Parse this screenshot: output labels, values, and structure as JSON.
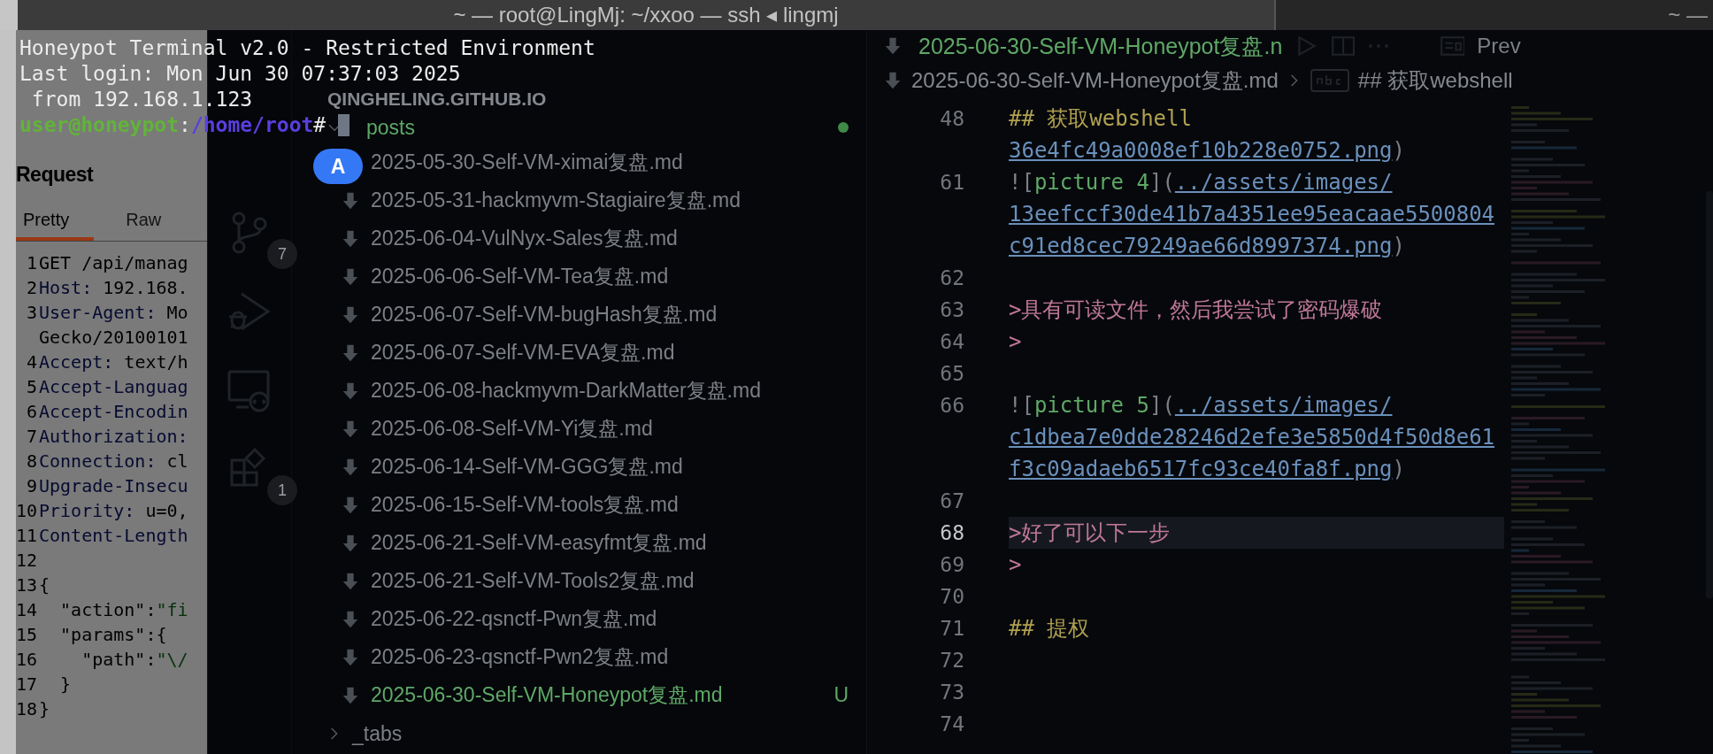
{
  "terminal": {
    "title": "~ — root@LingMj: ~/xxoo — ssh ◂ lingmj",
    "lines": [
      "Honeypot Terminal v2.0 - Restricted Environment",
      "Last login: Mon Jun 30 07:37:03 2025",
      " from 192.168.1.123"
    ],
    "prompt": {
      "user": "user@honeypot",
      "separator": ":",
      "path": "/home/root",
      "symbol": "#"
    },
    "input_badge": "A"
  },
  "second_window": {
    "title": "~ —"
  },
  "burp": {
    "heading": "Request",
    "tabs": [
      {
        "label": "Pretty",
        "selected": true
      },
      {
        "label": "Raw",
        "selected": false
      }
    ],
    "lines": [
      {
        "number": "1",
        "parts": [
          {
            "kind": "plain",
            "text": "GET /api/manag"
          }
        ]
      },
      {
        "number": "2",
        "parts": [
          {
            "kind": "name",
            "text": "Host:"
          },
          {
            "kind": "plain",
            "text": " 192.168."
          }
        ]
      },
      {
        "number": "3",
        "parts": [
          {
            "kind": "name",
            "text": "User-Agent:"
          },
          {
            "kind": "plain",
            "text": " Mo"
          }
        ]
      },
      {
        "parts": [
          {
            "kind": "plain",
            "text": "Gecko/20100101"
          }
        ]
      },
      {
        "number": "4",
        "parts": [
          {
            "kind": "name",
            "text": "Accept:"
          },
          {
            "kind": "plain",
            "text": " text/h"
          }
        ]
      },
      {
        "number": "5",
        "parts": [
          {
            "kind": "name",
            "text": "Accept-Languag"
          }
        ]
      },
      {
        "number": "6",
        "parts": [
          {
            "kind": "name",
            "text": "Accept-Encodin"
          }
        ]
      },
      {
        "number": "7",
        "parts": [
          {
            "kind": "name",
            "text": "Authorization:"
          }
        ]
      },
      {
        "number": "8",
        "parts": [
          {
            "kind": "name",
            "text": "Connection:"
          },
          {
            "kind": "plain",
            "text": " cl"
          }
        ]
      },
      {
        "number": "9",
        "parts": [
          {
            "kind": "name",
            "text": "Upgrade-Insecu"
          }
        ]
      },
      {
        "number": "10",
        "parts": [
          {
            "kind": "name",
            "text": "Priority:"
          },
          {
            "kind": "plain",
            "text": " u=0,"
          }
        ]
      },
      {
        "number": "11",
        "parts": [
          {
            "kind": "name",
            "text": "Content-Length"
          }
        ]
      },
      {
        "number": "12"
      },
      {
        "number": "13",
        "parts": [
          {
            "kind": "plain",
            "text": "{"
          }
        ]
      },
      {
        "number": "14",
        "parts": [
          {
            "kind": "plain",
            "text": "  \"action\":"
          },
          {
            "kind": "value",
            "text": "\"fi"
          }
        ]
      },
      {
        "number": "15",
        "parts": [
          {
            "kind": "plain",
            "text": "  \"params\":{"
          }
        ]
      },
      {
        "number": "16",
        "parts": [
          {
            "kind": "plain",
            "text": "    \"path\":"
          },
          {
            "kind": "value",
            "text": "\"\\/"
          }
        ]
      },
      {
        "number": "17",
        "parts": [
          {
            "kind": "plain",
            "text": "  }"
          }
        ]
      },
      {
        "number": "18",
        "parts": [
          {
            "kind": "plain",
            "text": "}"
          }
        ]
      }
    ]
  },
  "activity_bar": [
    {
      "kind": "source-control",
      "badge": "7"
    },
    {
      "kind": "debug"
    },
    {
      "kind": "remote"
    },
    {
      "kind": "extensions",
      "badge": "1"
    }
  ],
  "explorer": {
    "root": "QINGHELING.GITHUB.IO",
    "folders": [
      {
        "name": "posts",
        "expanded": true,
        "modified": true,
        "children": [
          {
            "name": "2025-05-30-Self-VM-ximai复盘.md"
          },
          {
            "name": "2025-05-31-hackmyvm-Stagiaire复盘.md"
          },
          {
            "name": "2025-06-04-VulNyx-Sales复盘.md"
          },
          {
            "name": "2025-06-06-Self-VM-Tea复盘.md"
          },
          {
            "name": "2025-06-07-Self-VM-bugHash复盘.md"
          },
          {
            "name": "2025-06-07-Self-VM-EVA复盘.md"
          },
          {
            "name": "2025-06-08-hackmyvm-DarkMatter复盘.md"
          },
          {
            "name": "2025-06-08-Self-VM-Yi复盘.md"
          },
          {
            "name": "2025-06-14-Self-VM-GGG复盘.md"
          },
          {
            "name": "2025-06-15-Self-VM-tools复盘.md"
          },
          {
            "name": "2025-06-21-Self-VM-easyfmt复盘.md"
          },
          {
            "name": "2025-06-21-Self-VM-Tools2复盘.md"
          },
          {
            "name": "2025-06-22-qsnctf-Pwn复盘.md"
          },
          {
            "name": "2025-06-23-qsnctf-Pwn2复盘.md"
          },
          {
            "name": "2025-06-30-Self-VM-Honeypot复盘.md",
            "status": "U"
          }
        ]
      },
      {
        "name": "_tabs",
        "expanded": false,
        "modified": false
      }
    ]
  },
  "editor": {
    "tab": "2025-06-30-Self-VM-Honeypot复盘.n",
    "preview_label": "Prev",
    "breadcrumb": {
      "file": "2025-06-30-Self-VM-Honeypot复盘.md",
      "symbol": "## 获取webshell"
    },
    "lines": [
      {
        "number": "48",
        "current": false,
        "parts": [
          {
            "kind": "heading",
            "text": "## 获取webshell"
          }
        ]
      },
      {
        "current": false,
        "parts": [
          {
            "kind": "link",
            "text": "36e4fc49a0008ef10b228e0752.png"
          },
          {
            "kind": "punct",
            "text": ")"
          }
        ]
      },
      {
        "number": "61",
        "current": false,
        "parts": [
          {
            "kind": "punct",
            "text": "!["
          },
          {
            "kind": "alt",
            "text": "picture 4"
          },
          {
            "kind": "punct",
            "text": "]("
          },
          {
            "kind": "link",
            "text": "../assets/images/"
          }
        ]
      },
      {
        "current": false,
        "parts": [
          {
            "kind": "link",
            "text": "13eefccf30de41b7a4351ee95eacaae5500804"
          }
        ]
      },
      {
        "current": false,
        "parts": [
          {
            "kind": "link",
            "text": "c91ed8cec79249ae66d8997374.png"
          },
          {
            "kind": "punct",
            "text": ")"
          }
        ]
      },
      {
        "number": "62",
        "current": false
      },
      {
        "number": "63",
        "current": false,
        "parts": [
          {
            "kind": "quote",
            "text": ">具有可读文件，然后我尝试了密码爆破"
          }
        ]
      },
      {
        "number": "64",
        "current": false,
        "parts": [
          {
            "kind": "quote",
            "text": ">"
          }
        ]
      },
      {
        "number": "65",
        "current": false
      },
      {
        "number": "66",
        "current": false,
        "parts": [
          {
            "kind": "punct",
            "text": "!["
          },
          {
            "kind": "alt",
            "text": "picture 5"
          },
          {
            "kind": "punct",
            "text": "]("
          },
          {
            "kind": "link",
            "text": "../assets/images/"
          }
        ]
      },
      {
        "current": false,
        "parts": [
          {
            "kind": "link",
            "text": "c1dbea7e0dde28246d2efe3e5850d4f50d8e61"
          }
        ]
      },
      {
        "current": false,
        "parts": [
          {
            "kind": "link",
            "text": "f3c09adaeb6517fc93ce40fa8f.png"
          },
          {
            "kind": "punct",
            "text": ")"
          }
        ]
      },
      {
        "number": "67",
        "current": false
      },
      {
        "number": "68",
        "current": true,
        "parts": [
          {
            "kind": "quote",
            "text": ">好了可以下一步"
          }
        ]
      },
      {
        "number": "69",
        "current": false,
        "parts": [
          {
            "kind": "quote",
            "text": ">"
          }
        ]
      },
      {
        "number": "70",
        "current": false
      },
      {
        "number": "71",
        "current": false,
        "parts": [
          {
            "kind": "heading",
            "text": "## 提权"
          }
        ]
      },
      {
        "number": "72",
        "current": false
      },
      {
        "number": "73",
        "current": false
      },
      {
        "number": "74",
        "current": false
      }
    ]
  }
}
